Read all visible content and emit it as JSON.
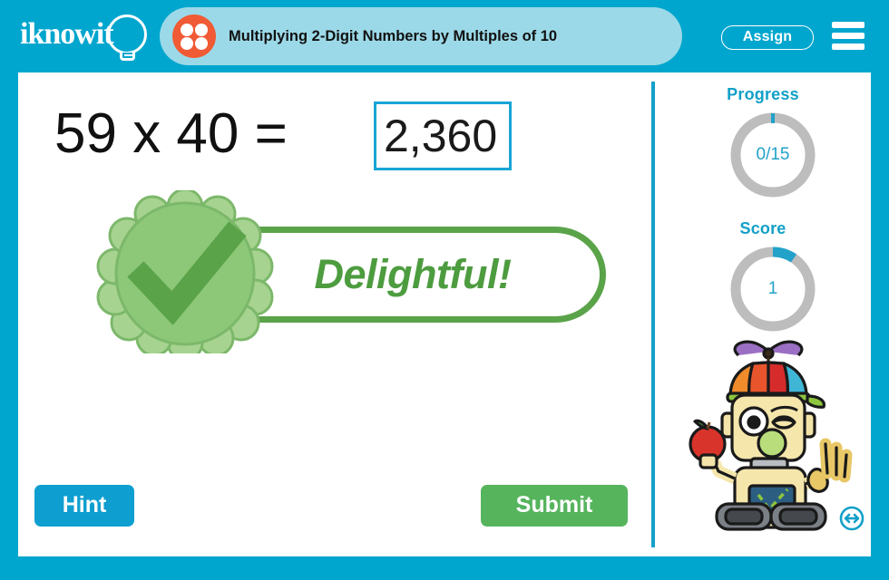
{
  "brand": {
    "name": "iknowit",
    "logo_icon": "lightbulb-icon"
  },
  "header": {
    "lesson_title": "Multiplying 2-Digit Numbers by Multiples of 10",
    "lesson_icon": "four-dots-circle-icon",
    "assign_label": "Assign",
    "menu_icon": "hamburger-menu-icon",
    "bar_color": "#00a6ce",
    "pill_color": "#9cd9e8",
    "icon_color": "#f05a34"
  },
  "problem": {
    "expression": "59 x 40 =",
    "factor_a": "59",
    "operator": "x",
    "factor_b": "40",
    "equals": "=",
    "answer_value": "2,360",
    "answer_placeholder": "",
    "box_border_color": "#18a5d6"
  },
  "feedback": {
    "message": "Delightful!",
    "state": "correct",
    "badge_icon": "check-mark-rosette-icon",
    "color": "#4d9c3f",
    "badge_fill": "#8cc878",
    "badge_outline": "#5aa349"
  },
  "actions": {
    "hint_label": "Hint",
    "hint_color": "#0e9fd0",
    "submit_label": "Submit",
    "submit_color": "#56b45d"
  },
  "sidebar": {
    "progress": {
      "label": "Progress",
      "value": "0/15",
      "completed": 0,
      "total": 15,
      "percent": 0,
      "track_color": "#bdbdbd",
      "fill_color": "#22a2c9"
    },
    "score": {
      "label": "Score",
      "value": "1",
      "percent": 8,
      "track_color": "#bdbdbd",
      "fill_color": "#22a2c9"
    },
    "mascot_icon": "robot-mascot-with-apple-icon",
    "resize_icon": "horizontal-resize-arrows-icon"
  }
}
